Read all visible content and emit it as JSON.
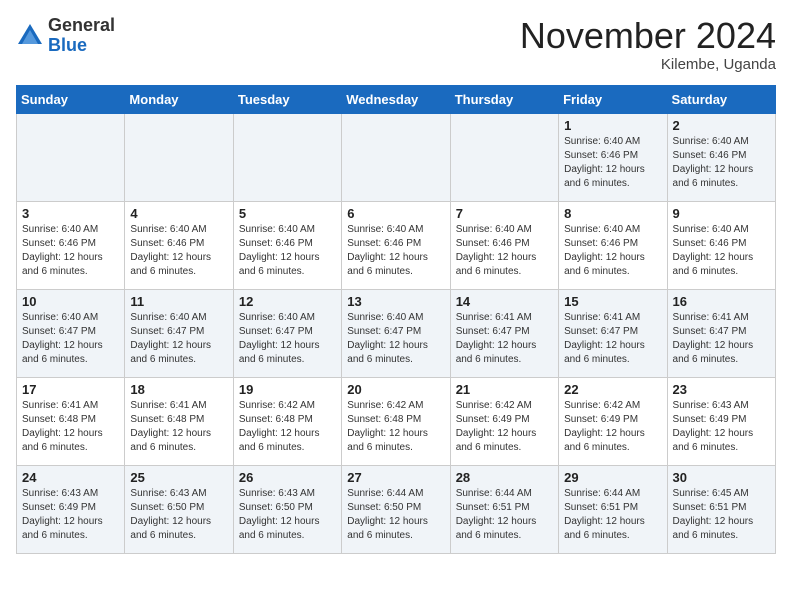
{
  "header": {
    "logo_general": "General",
    "logo_blue": "Blue",
    "month_title": "November 2024",
    "location": "Kilembe, Uganda"
  },
  "days_of_week": [
    "Sunday",
    "Monday",
    "Tuesday",
    "Wednesday",
    "Thursday",
    "Friday",
    "Saturday"
  ],
  "weeks": [
    [
      {
        "day": "",
        "info": ""
      },
      {
        "day": "",
        "info": ""
      },
      {
        "day": "",
        "info": ""
      },
      {
        "day": "",
        "info": ""
      },
      {
        "day": "",
        "info": ""
      },
      {
        "day": "1",
        "info": "Sunrise: 6:40 AM\nSunset: 6:46 PM\nDaylight: 12 hours and 6 minutes."
      },
      {
        "day": "2",
        "info": "Sunrise: 6:40 AM\nSunset: 6:46 PM\nDaylight: 12 hours and 6 minutes."
      }
    ],
    [
      {
        "day": "3",
        "info": "Sunrise: 6:40 AM\nSunset: 6:46 PM\nDaylight: 12 hours and 6 minutes."
      },
      {
        "day": "4",
        "info": "Sunrise: 6:40 AM\nSunset: 6:46 PM\nDaylight: 12 hours and 6 minutes."
      },
      {
        "day": "5",
        "info": "Sunrise: 6:40 AM\nSunset: 6:46 PM\nDaylight: 12 hours and 6 minutes."
      },
      {
        "day": "6",
        "info": "Sunrise: 6:40 AM\nSunset: 6:46 PM\nDaylight: 12 hours and 6 minutes."
      },
      {
        "day": "7",
        "info": "Sunrise: 6:40 AM\nSunset: 6:46 PM\nDaylight: 12 hours and 6 minutes."
      },
      {
        "day": "8",
        "info": "Sunrise: 6:40 AM\nSunset: 6:46 PM\nDaylight: 12 hours and 6 minutes."
      },
      {
        "day": "9",
        "info": "Sunrise: 6:40 AM\nSunset: 6:46 PM\nDaylight: 12 hours and 6 minutes."
      }
    ],
    [
      {
        "day": "10",
        "info": "Sunrise: 6:40 AM\nSunset: 6:47 PM\nDaylight: 12 hours and 6 minutes."
      },
      {
        "day": "11",
        "info": "Sunrise: 6:40 AM\nSunset: 6:47 PM\nDaylight: 12 hours and 6 minutes."
      },
      {
        "day": "12",
        "info": "Sunrise: 6:40 AM\nSunset: 6:47 PM\nDaylight: 12 hours and 6 minutes."
      },
      {
        "day": "13",
        "info": "Sunrise: 6:40 AM\nSunset: 6:47 PM\nDaylight: 12 hours and 6 minutes."
      },
      {
        "day": "14",
        "info": "Sunrise: 6:41 AM\nSunset: 6:47 PM\nDaylight: 12 hours and 6 minutes."
      },
      {
        "day": "15",
        "info": "Sunrise: 6:41 AM\nSunset: 6:47 PM\nDaylight: 12 hours and 6 minutes."
      },
      {
        "day": "16",
        "info": "Sunrise: 6:41 AM\nSunset: 6:47 PM\nDaylight: 12 hours and 6 minutes."
      }
    ],
    [
      {
        "day": "17",
        "info": "Sunrise: 6:41 AM\nSunset: 6:48 PM\nDaylight: 12 hours and 6 minutes."
      },
      {
        "day": "18",
        "info": "Sunrise: 6:41 AM\nSunset: 6:48 PM\nDaylight: 12 hours and 6 minutes."
      },
      {
        "day": "19",
        "info": "Sunrise: 6:42 AM\nSunset: 6:48 PM\nDaylight: 12 hours and 6 minutes."
      },
      {
        "day": "20",
        "info": "Sunrise: 6:42 AM\nSunset: 6:48 PM\nDaylight: 12 hours and 6 minutes."
      },
      {
        "day": "21",
        "info": "Sunrise: 6:42 AM\nSunset: 6:49 PM\nDaylight: 12 hours and 6 minutes."
      },
      {
        "day": "22",
        "info": "Sunrise: 6:42 AM\nSunset: 6:49 PM\nDaylight: 12 hours and 6 minutes."
      },
      {
        "day": "23",
        "info": "Sunrise: 6:43 AM\nSunset: 6:49 PM\nDaylight: 12 hours and 6 minutes."
      }
    ],
    [
      {
        "day": "24",
        "info": "Sunrise: 6:43 AM\nSunset: 6:49 PM\nDaylight: 12 hours and 6 minutes."
      },
      {
        "day": "25",
        "info": "Sunrise: 6:43 AM\nSunset: 6:50 PM\nDaylight: 12 hours and 6 minutes."
      },
      {
        "day": "26",
        "info": "Sunrise: 6:43 AM\nSunset: 6:50 PM\nDaylight: 12 hours and 6 minutes."
      },
      {
        "day": "27",
        "info": "Sunrise: 6:44 AM\nSunset: 6:50 PM\nDaylight: 12 hours and 6 minutes."
      },
      {
        "day": "28",
        "info": "Sunrise: 6:44 AM\nSunset: 6:51 PM\nDaylight: 12 hours and 6 minutes."
      },
      {
        "day": "29",
        "info": "Sunrise: 6:44 AM\nSunset: 6:51 PM\nDaylight: 12 hours and 6 minutes."
      },
      {
        "day": "30",
        "info": "Sunrise: 6:45 AM\nSunset: 6:51 PM\nDaylight: 12 hours and 6 minutes."
      }
    ]
  ]
}
